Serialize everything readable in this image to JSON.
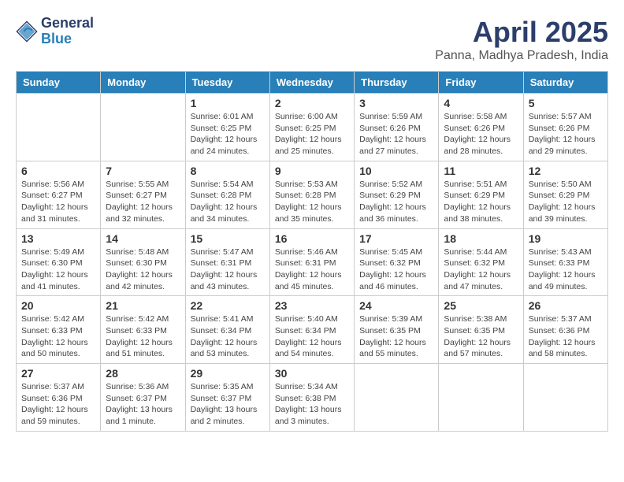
{
  "logo": {
    "general": "General",
    "blue": "Blue"
  },
  "title": "April 2025",
  "location": "Panna, Madhya Pradesh, India",
  "weekdays": [
    "Sunday",
    "Monday",
    "Tuesday",
    "Wednesday",
    "Thursday",
    "Friday",
    "Saturday"
  ],
  "days": [
    {
      "num": "",
      "sunrise": "",
      "sunset": "",
      "daylight": ""
    },
    {
      "num": "",
      "sunrise": "",
      "sunset": "",
      "daylight": ""
    },
    {
      "num": "1",
      "sunrise": "Sunrise: 6:01 AM",
      "sunset": "Sunset: 6:25 PM",
      "daylight": "Daylight: 12 hours and 24 minutes."
    },
    {
      "num": "2",
      "sunrise": "Sunrise: 6:00 AM",
      "sunset": "Sunset: 6:25 PM",
      "daylight": "Daylight: 12 hours and 25 minutes."
    },
    {
      "num": "3",
      "sunrise": "Sunrise: 5:59 AM",
      "sunset": "Sunset: 6:26 PM",
      "daylight": "Daylight: 12 hours and 27 minutes."
    },
    {
      "num": "4",
      "sunrise": "Sunrise: 5:58 AM",
      "sunset": "Sunset: 6:26 PM",
      "daylight": "Daylight: 12 hours and 28 minutes."
    },
    {
      "num": "5",
      "sunrise": "Sunrise: 5:57 AM",
      "sunset": "Sunset: 6:26 PM",
      "daylight": "Daylight: 12 hours and 29 minutes."
    },
    {
      "num": "6",
      "sunrise": "Sunrise: 5:56 AM",
      "sunset": "Sunset: 6:27 PM",
      "daylight": "Daylight: 12 hours and 31 minutes."
    },
    {
      "num": "7",
      "sunrise": "Sunrise: 5:55 AM",
      "sunset": "Sunset: 6:27 PM",
      "daylight": "Daylight: 12 hours and 32 minutes."
    },
    {
      "num": "8",
      "sunrise": "Sunrise: 5:54 AM",
      "sunset": "Sunset: 6:28 PM",
      "daylight": "Daylight: 12 hours and 34 minutes."
    },
    {
      "num": "9",
      "sunrise": "Sunrise: 5:53 AM",
      "sunset": "Sunset: 6:28 PM",
      "daylight": "Daylight: 12 hours and 35 minutes."
    },
    {
      "num": "10",
      "sunrise": "Sunrise: 5:52 AM",
      "sunset": "Sunset: 6:29 PM",
      "daylight": "Daylight: 12 hours and 36 minutes."
    },
    {
      "num": "11",
      "sunrise": "Sunrise: 5:51 AM",
      "sunset": "Sunset: 6:29 PM",
      "daylight": "Daylight: 12 hours and 38 minutes."
    },
    {
      "num": "12",
      "sunrise": "Sunrise: 5:50 AM",
      "sunset": "Sunset: 6:29 PM",
      "daylight": "Daylight: 12 hours and 39 minutes."
    },
    {
      "num": "13",
      "sunrise": "Sunrise: 5:49 AM",
      "sunset": "Sunset: 6:30 PM",
      "daylight": "Daylight: 12 hours and 41 minutes."
    },
    {
      "num": "14",
      "sunrise": "Sunrise: 5:48 AM",
      "sunset": "Sunset: 6:30 PM",
      "daylight": "Daylight: 12 hours and 42 minutes."
    },
    {
      "num": "15",
      "sunrise": "Sunrise: 5:47 AM",
      "sunset": "Sunset: 6:31 PM",
      "daylight": "Daylight: 12 hours and 43 minutes."
    },
    {
      "num": "16",
      "sunrise": "Sunrise: 5:46 AM",
      "sunset": "Sunset: 6:31 PM",
      "daylight": "Daylight: 12 hours and 45 minutes."
    },
    {
      "num": "17",
      "sunrise": "Sunrise: 5:45 AM",
      "sunset": "Sunset: 6:32 PM",
      "daylight": "Daylight: 12 hours and 46 minutes."
    },
    {
      "num": "18",
      "sunrise": "Sunrise: 5:44 AM",
      "sunset": "Sunset: 6:32 PM",
      "daylight": "Daylight: 12 hours and 47 minutes."
    },
    {
      "num": "19",
      "sunrise": "Sunrise: 5:43 AM",
      "sunset": "Sunset: 6:33 PM",
      "daylight": "Daylight: 12 hours and 49 minutes."
    },
    {
      "num": "20",
      "sunrise": "Sunrise: 5:42 AM",
      "sunset": "Sunset: 6:33 PM",
      "daylight": "Daylight: 12 hours and 50 minutes."
    },
    {
      "num": "21",
      "sunrise": "Sunrise: 5:42 AM",
      "sunset": "Sunset: 6:33 PM",
      "daylight": "Daylight: 12 hours and 51 minutes."
    },
    {
      "num": "22",
      "sunrise": "Sunrise: 5:41 AM",
      "sunset": "Sunset: 6:34 PM",
      "daylight": "Daylight: 12 hours and 53 minutes."
    },
    {
      "num": "23",
      "sunrise": "Sunrise: 5:40 AM",
      "sunset": "Sunset: 6:34 PM",
      "daylight": "Daylight: 12 hours and 54 minutes."
    },
    {
      "num": "24",
      "sunrise": "Sunrise: 5:39 AM",
      "sunset": "Sunset: 6:35 PM",
      "daylight": "Daylight: 12 hours and 55 minutes."
    },
    {
      "num": "25",
      "sunrise": "Sunrise: 5:38 AM",
      "sunset": "Sunset: 6:35 PM",
      "daylight": "Daylight: 12 hours and 57 minutes."
    },
    {
      "num": "26",
      "sunrise": "Sunrise: 5:37 AM",
      "sunset": "Sunset: 6:36 PM",
      "daylight": "Daylight: 12 hours and 58 minutes."
    },
    {
      "num": "27",
      "sunrise": "Sunrise: 5:37 AM",
      "sunset": "Sunset: 6:36 PM",
      "daylight": "Daylight: 12 hours and 59 minutes."
    },
    {
      "num": "28",
      "sunrise": "Sunrise: 5:36 AM",
      "sunset": "Sunset: 6:37 PM",
      "daylight": "Daylight: 13 hours and 1 minute."
    },
    {
      "num": "29",
      "sunrise": "Sunrise: 5:35 AM",
      "sunset": "Sunset: 6:37 PM",
      "daylight": "Daylight: 13 hours and 2 minutes."
    },
    {
      "num": "30",
      "sunrise": "Sunrise: 5:34 AM",
      "sunset": "Sunset: 6:38 PM",
      "daylight": "Daylight: 13 hours and 3 minutes."
    },
    {
      "num": "",
      "sunrise": "",
      "sunset": "",
      "daylight": ""
    },
    {
      "num": "",
      "sunrise": "",
      "sunset": "",
      "daylight": ""
    },
    {
      "num": "",
      "sunrise": "",
      "sunset": "",
      "daylight": ""
    }
  ]
}
